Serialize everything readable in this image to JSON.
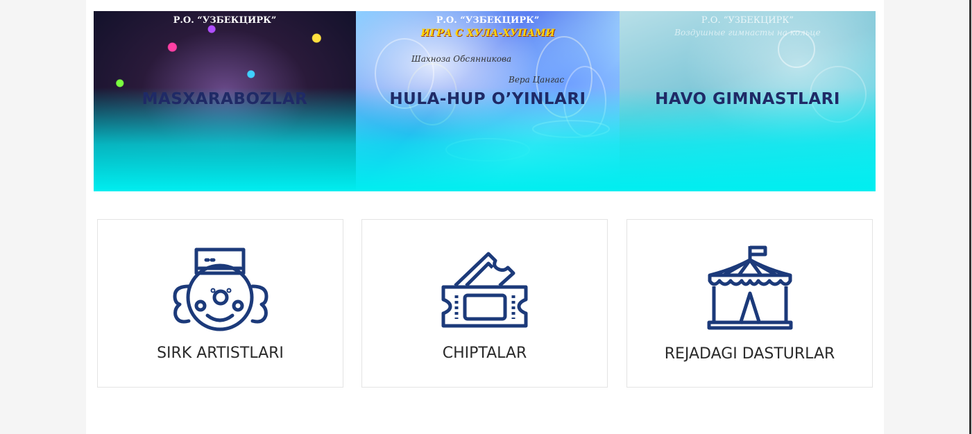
{
  "banners": [
    {
      "title": "MASXARABOZLAR",
      "troupe": "Р.О. “УЗБЕКЦИРК”"
    },
    {
      "title": "HULA-HUP O’YINLARI",
      "troupe": "Р.О. “УЗБЕКЦИРК”",
      "subtitle": "ИГРА С ХУЛА-ХУПАМИ",
      "artist_1": "Шахноза Обсянникова",
      "artist_2": "Вера Цангас"
    },
    {
      "title": "HAVO GIMNASTLARI",
      "troupe": "Р.О. “УЗБЕКЦИРК”",
      "subtitle": "Воздушные гимнасты на кольце"
    }
  ],
  "cards": [
    {
      "label": "SIRK ARTISTLARI",
      "icon": "clown-icon"
    },
    {
      "label": "CHIPTALAR",
      "icon": "ticket-icon"
    },
    {
      "label": "REJADAGI DASTURLAR",
      "icon": "circus-tent-icon"
    }
  ],
  "colors": {
    "icon_stroke": "#1c3a7a",
    "banner_title": "#1f2a66",
    "banner_fade": "#00eef0"
  }
}
